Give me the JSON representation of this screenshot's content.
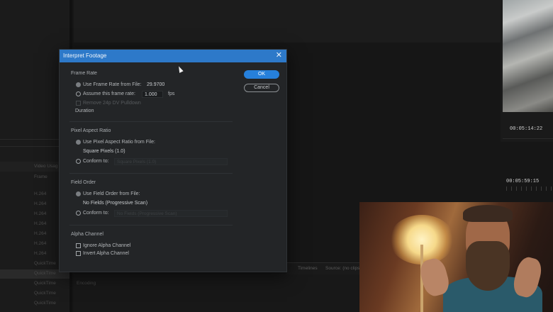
{
  "dialog": {
    "title": "Interpret Footage",
    "frame_rate": {
      "heading": "Frame Rate",
      "use_from_file_label": "Use Frame Rate from File:",
      "file_rate_value": "29.9700",
      "assume_label": "Assume this frame rate:",
      "assume_value": "1.000",
      "fps_unit": "fps",
      "remove_pulldown_label": "Remove 24p DV Pulldown",
      "duration_label": "Duration"
    },
    "pixel_aspect": {
      "heading": "Pixel Aspect Ratio",
      "use_from_file_label": "Use Pixel Aspect Ratio from File:",
      "file_value": "Square Pixels (1.0)",
      "conform_label": "Conform to:",
      "conform_select": "Square Pixels (1.0)"
    },
    "field_order": {
      "heading": "Field Order",
      "use_from_file_label": "Use Field Order from File:",
      "file_value": "No Fields (Progressive Scan)",
      "conform_label": "Conform to:",
      "conform_select": "No Fields (Progressive Scan)"
    },
    "alpha": {
      "heading": "Alpha Channel",
      "ignore_label": "Ignore Alpha Channel",
      "invert_label": "Invert Alpha Channel"
    },
    "ok_label": "OK",
    "cancel_label": "Cancel",
    "close_glyph": "✕"
  },
  "background": {
    "timecode_1": "00:05:14:22",
    "timecode_2": "00:05:59:15",
    "project_header_1": "Video Usag",
    "project_header_2": "Frame",
    "project_rows": [
      "H.264",
      "H.264",
      "H.264",
      "H.264",
      "H.264",
      "H.264",
      "H.264",
      "QuickTime",
      "QuickTime",
      "QuickTime",
      "QuickTime",
      "QuickTime"
    ],
    "bottom_tabs": [
      "Timelines",
      "Source: (no clips)"
    ],
    "bottom_label": "Encoding"
  },
  "colors": {
    "titlebar": "#2d79c9",
    "ok_button": "#2680db"
  }
}
